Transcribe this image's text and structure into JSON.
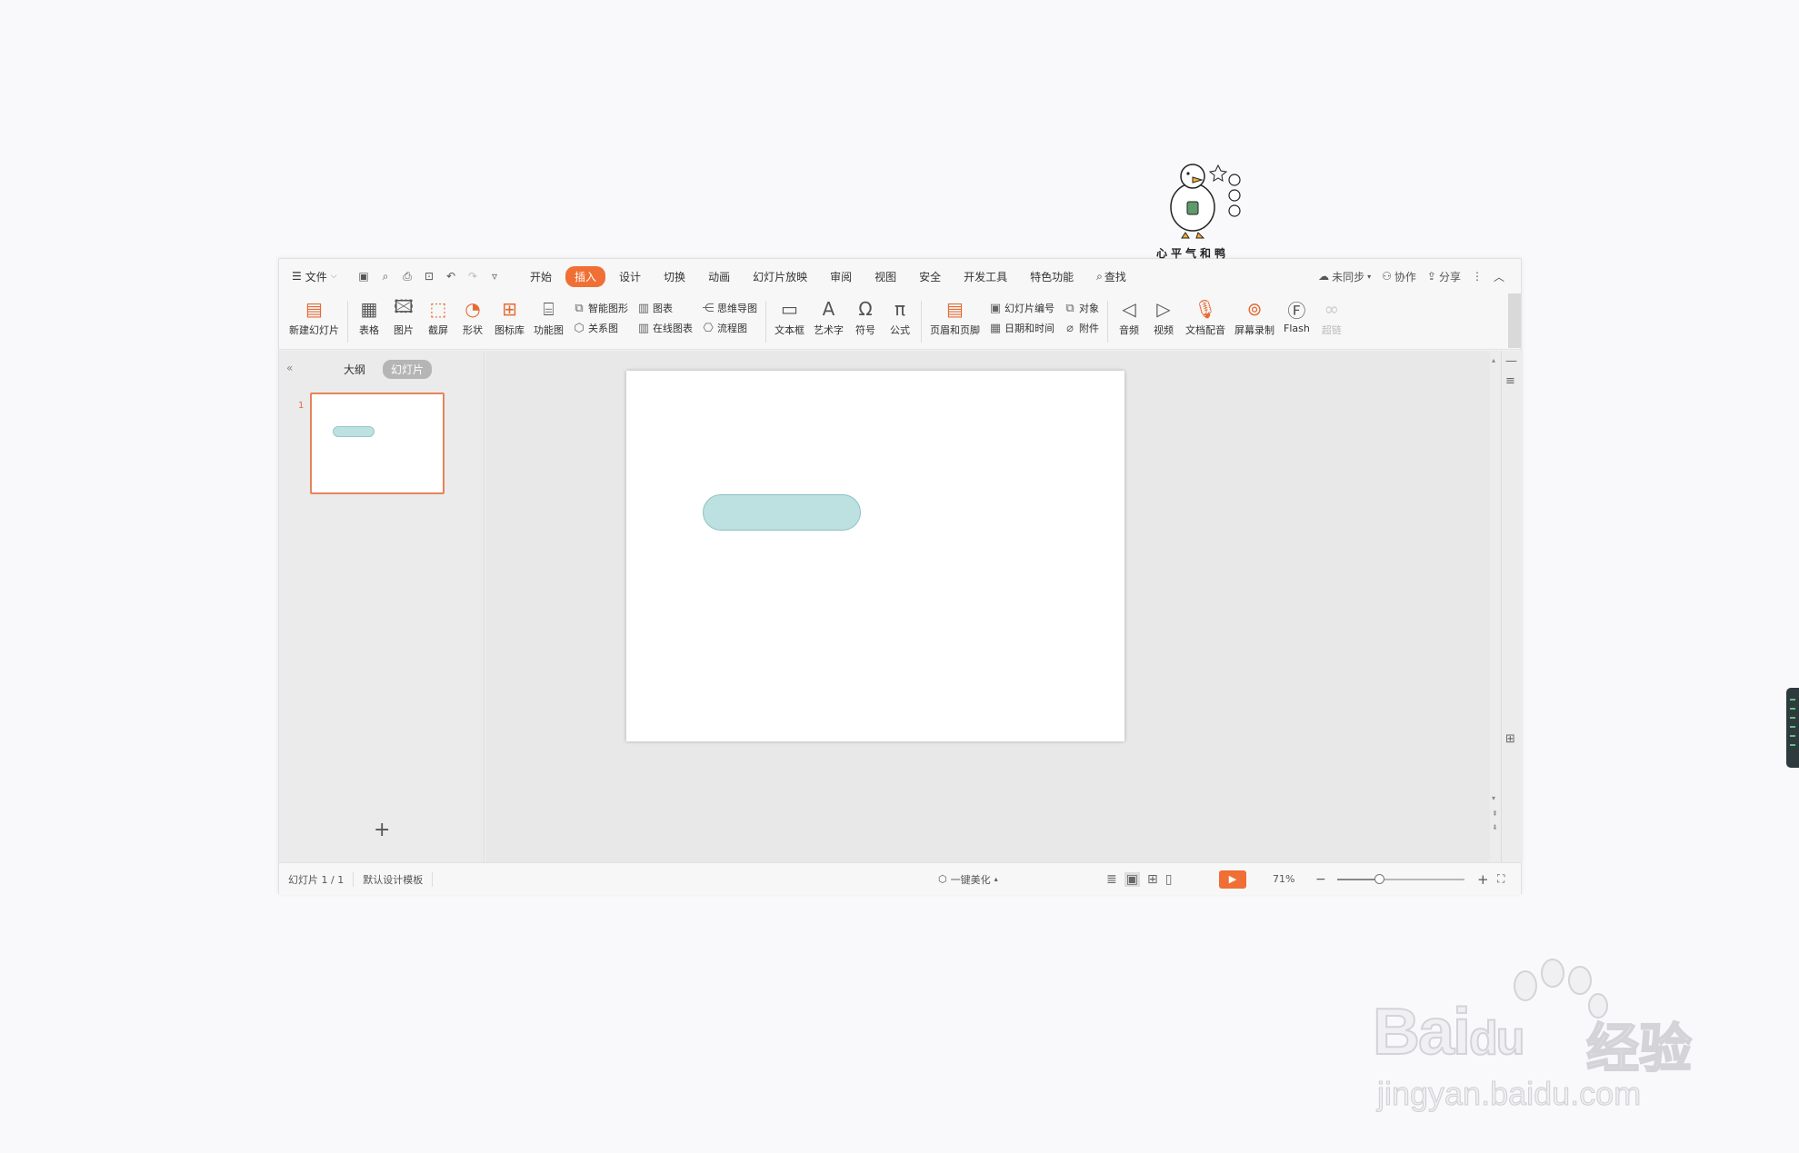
{
  "menubar": {
    "file_label": "文件",
    "tabs": [
      {
        "label": "开始",
        "active": false
      },
      {
        "label": "插入",
        "active": true
      },
      {
        "label": "设计",
        "active": false
      },
      {
        "label": "切换",
        "active": false
      },
      {
        "label": "动画",
        "active": false
      },
      {
        "label": "幻灯片放映",
        "active": false
      },
      {
        "label": "审阅",
        "active": false
      },
      {
        "label": "视图",
        "active": false
      },
      {
        "label": "安全",
        "active": false
      },
      {
        "label": "开发工具",
        "active": false
      },
      {
        "label": "特色功能",
        "active": false
      }
    ],
    "search_label": "查找",
    "sync_label": "未同步",
    "collab_label": "协作",
    "share_label": "分享"
  },
  "ribbon": {
    "new_slide": "新建幻灯片",
    "table": "表格",
    "picture": "图片",
    "screenshot": "截屏",
    "shape": "形状",
    "icon_lib": "图标库",
    "func_chart": "功能图",
    "smart_shape": "智能图形",
    "chart": "图表",
    "relation": "关系图",
    "online_chart": "在线图表",
    "mindmap": "思维导图",
    "flowchart": "流程图",
    "textbox": "文本框",
    "wordart": "艺术字",
    "symbol": "符号",
    "formula": "公式",
    "header_footer": "页眉和页脚",
    "slide_number": "幻灯片编号",
    "object": "对象",
    "date_time": "日期和时间",
    "attachment": "附件",
    "audio": "音频",
    "video": "视频",
    "doc_voice": "文档配音",
    "screen_record": "屏幕录制",
    "flash": "Flash",
    "hyperlink": "超链"
  },
  "leftpanel": {
    "outline_tab": "大纲",
    "slides_tab": "幻灯片",
    "slide_number": "1"
  },
  "sticker_caption": "心平气和鸭",
  "statusbar": {
    "slide_info": "幻灯片 1 / 1",
    "template": "默认设计模板",
    "beautify": "一键美化",
    "zoom": "71%",
    "zoom_value": 0.33
  },
  "watermark": {
    "brand": "Bai",
    "brand_tail": "du",
    "cn": "经验",
    "url": "jingyan.baidu.com"
  },
  "colors": {
    "accent": "#f06f35",
    "shape_fill": "#bde0e1",
    "shape_border": "#8fc3c6"
  }
}
